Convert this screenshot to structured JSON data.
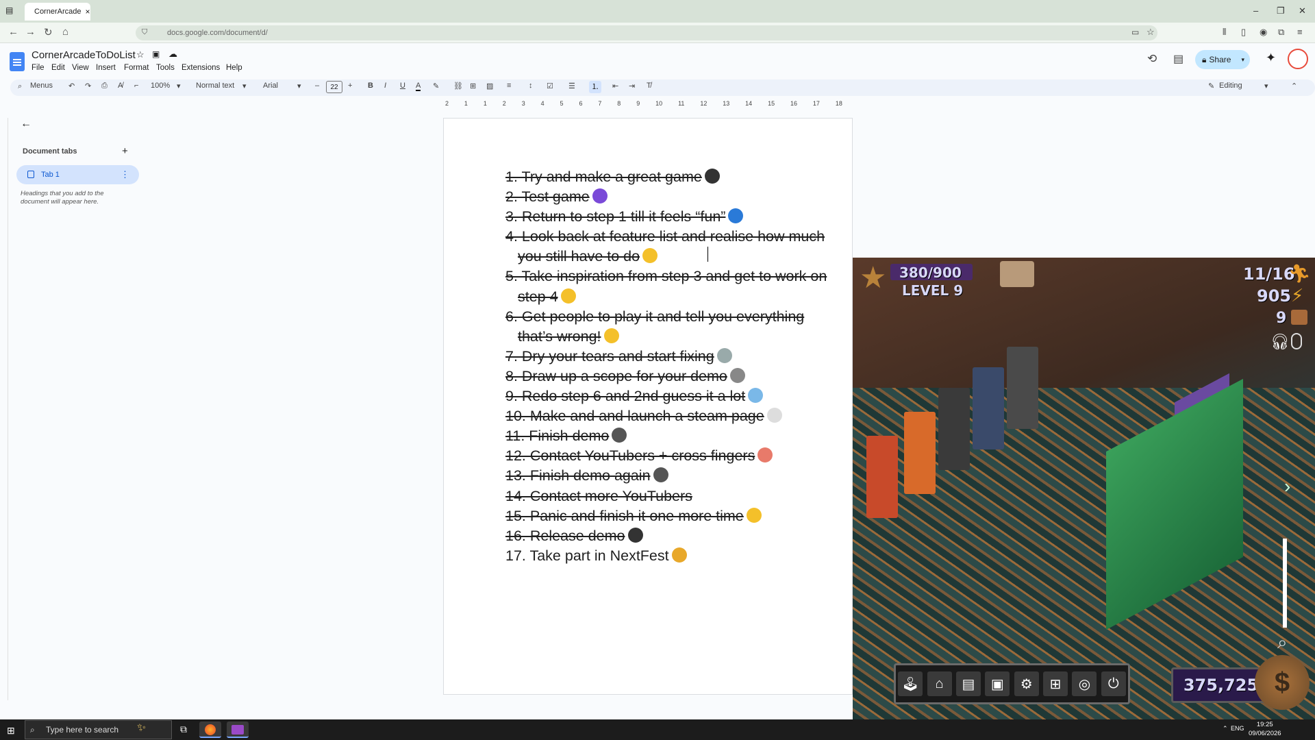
{
  "browser": {
    "tab_title": "CornerArcade",
    "url": "docs.google.com/document/d/"
  },
  "docs": {
    "title": "CornerArcadeToDoList",
    "menus": [
      "File",
      "Edit",
      "View",
      "Insert",
      "Format",
      "Tools",
      "Extensions",
      "Help"
    ],
    "share_label": "Share",
    "toolbar": {
      "menus_label": "Menus",
      "zoom": "100%",
      "style": "Normal text",
      "font": "Arial",
      "font_size": "22",
      "mode": "Editing"
    },
    "ruler_ticks": [
      "2",
      "1",
      "1",
      "2",
      "3",
      "4",
      "5",
      "6",
      "7",
      "8",
      "9",
      "10",
      "11",
      "12",
      "13",
      "14",
      "15",
      "16",
      "17",
      "18"
    ],
    "sidebar": {
      "heading": "Document tabs",
      "tab_label": "Tab 1",
      "hint": "Headings that you add to the document will appear here."
    },
    "todo": [
      {
        "text": "1.   Try and make a great game",
        "done": true,
        "emoji": "joystick"
      },
      {
        "text": "2.   Test game",
        "done": true,
        "emoji": "space-invader"
      },
      {
        "text": "3.   Return to step 1 till it feels “fun”",
        "done": true,
        "emoji": "repeat"
      },
      {
        "text": "4.   Look back at feature list and realise how much you still have to do",
        "done": true,
        "emoji": "expressionless-face"
      },
      {
        "text": "5.   Take inspiration from step 3 and get to work on step 4",
        "done": true,
        "emoji": "grinning-face"
      },
      {
        "text": "6.   Get people to play it and tell you everything that’s wrong!",
        "done": true,
        "emoji": "grimacing-face"
      },
      {
        "text": "7.   Dry your tears and start fixing",
        "done": true,
        "emoji": "wrench"
      },
      {
        "text": "8.   Draw up a scope for your demo",
        "done": true,
        "emoji": "book"
      },
      {
        "text": "9.   Redo step 6 and 2nd guess it a lot",
        "done": true,
        "emoji": "anxious-face"
      },
      {
        "text": "10.  Make and and launch a steam page",
        "done": true,
        "emoji": "page"
      },
      {
        "text": "11. Finish demo",
        "done": true,
        "emoji": "chequered-flag"
      },
      {
        "text": "12. Contact YouTubers + cross fingers",
        "done": true,
        "emoji": "inbox"
      },
      {
        "text": "13. Finish demo again",
        "done": true,
        "emoji": "chequered-flag"
      },
      {
        "text": "14. Contact more YouTubers",
        "done": true,
        "emoji": ""
      },
      {
        "text": "15. Panic and finish it one more time",
        "done": true,
        "emoji": "face-flag-flag"
      },
      {
        "text": "16. Release demo",
        "done": true,
        "emoji": "game-controller"
      },
      {
        "text": "17. Take part in NextFest",
        "done": false,
        "emoji": "party-popper"
      }
    ]
  },
  "game": {
    "xp": "380/900",
    "level": "LEVEL 9",
    "customers": "11/16",
    "energy": "905",
    "items": "9",
    "money": "375,725",
    "hotbar_icons": [
      "joystick",
      "shop",
      "briefcase",
      "save",
      "settings",
      "network",
      "steam",
      "power"
    ]
  },
  "taskbar": {
    "search_placeholder": "Type here to search",
    "lang": "ENG",
    "time": "19:25",
    "date": "09/06/2026"
  },
  "colors": {
    "docs_blue": "#0b57d0",
    "tab_highlight": "#d3e3fd",
    "taskbar": "#1c1c1c"
  }
}
